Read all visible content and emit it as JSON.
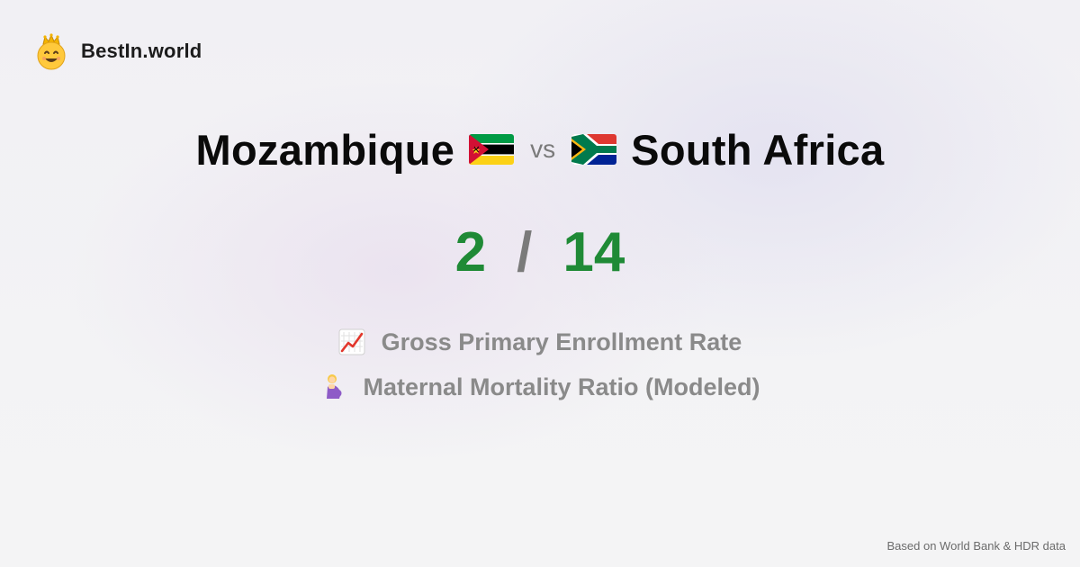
{
  "brand": {
    "name": "BestIn.world",
    "logo_icon": "crowned-smiley-icon"
  },
  "comparison": {
    "left_country": "Mozambique",
    "left_flag": "mozambique-flag-icon",
    "vs_label": "vs",
    "right_country": "South Africa",
    "right_flag": "south-africa-flag-icon"
  },
  "score": {
    "left": "2",
    "separator": "/",
    "right": "14",
    "score_color": "#1f8a36"
  },
  "metrics": [
    {
      "icon": "chart-increasing-icon",
      "label": "Gross Primary Enrollment Rate"
    },
    {
      "icon": "pregnant-woman-icon",
      "label": "Maternal Mortality Ratio (Modeled)"
    }
  ],
  "footer": {
    "source": "Based on World Bank & HDR data"
  }
}
